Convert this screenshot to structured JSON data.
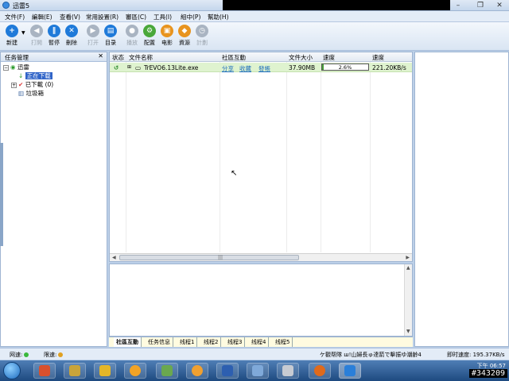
{
  "window": {
    "title": "迅雷5"
  },
  "menu": [
    "文件(F)",
    "編輯(E)",
    "查看(V)",
    "常用設置(R)",
    "審區(C)",
    "工具(I)",
    "組中(P)",
    "幫助(H)"
  ],
  "toolbar": {
    "new": "新建",
    "open": "打開",
    "pause": "暫停",
    "delete": "刪除",
    "openfile": "打开",
    "dir": "目录",
    "play": "播放",
    "config": "配置",
    "movie": "电影",
    "resource": "資源",
    "timer": "計劃"
  },
  "left": {
    "header": "任务管理",
    "root": "迅雷",
    "downloading": "正在下载",
    "downloaded": "已下載",
    "downloaded_count": "(0)",
    "trash": "垃圾箱"
  },
  "table": {
    "headers": [
      "状态",
      "文件名称",
      "社區互動",
      "文件大小",
      "速度",
      "速度"
    ],
    "rows": [
      {
        "name": "TrEVO6.13Lite.exe",
        "share": "分享",
        "fav": "收藏",
        "comment": "發帳",
        "size": "37.90MB",
        "progress_label": "2.6%",
        "progress": 0.026,
        "speed": "221.20KB/s"
      }
    ]
  },
  "tabs": [
    "社區互動",
    "任务信息",
    "线程1",
    "线程2",
    "线程3",
    "线程4",
    "线程5"
  ],
  "status": {
    "network": "网速:",
    "speedlimit": "限速:",
    "notice": "ケ觀帮隊 ш!山婦長ゅ達箭で擊振ゆ潮齢4",
    "speed": "即时速度: 195.37KB/s"
  },
  "tray": {
    "time": "下午 06:57"
  },
  "watermark": "#343209",
  "colors": {
    "accent": "#3064c8",
    "row_bg": "#dff3cf",
    "progress": "#4a9e3a"
  }
}
